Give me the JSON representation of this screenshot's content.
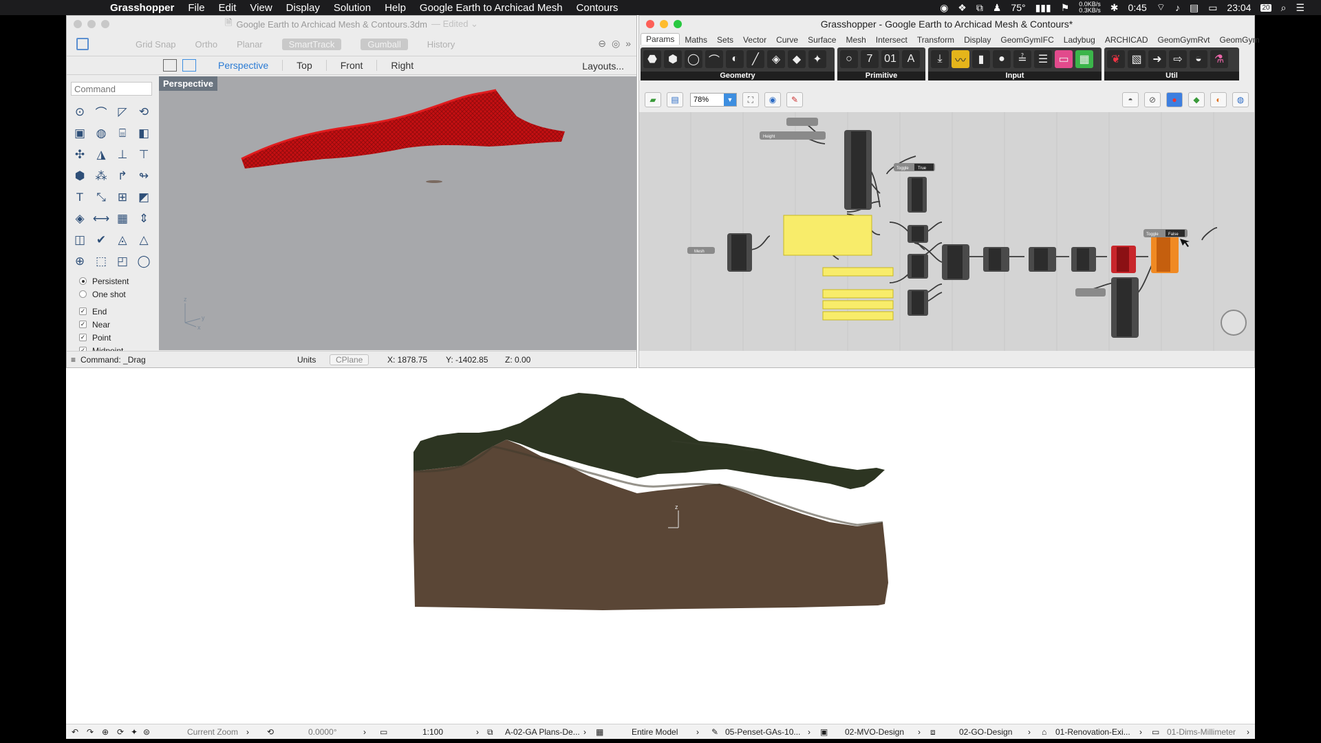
{
  "menubar": {
    "app": "Grasshopper",
    "items": [
      "File",
      "Edit",
      "View",
      "Display",
      "Solution",
      "Help",
      "Google Earth to Archicad Mesh",
      "Contours"
    ],
    "temp": "75°",
    "net_up": "0.0KB/s",
    "net_down": "0.3KB/s",
    "timer": "0:45",
    "clock": "23:04",
    "date_badge": "20"
  },
  "rhino": {
    "title": "Google Earth to Archicad Mesh & Contours.3dm",
    "title_suffix": "— Edited ⌄",
    "toggles": [
      "Grid Snap",
      "Ortho",
      "Planar",
      "SmartTrack",
      "Gumball",
      "History"
    ],
    "view_tabs": [
      "Perspective",
      "Top",
      "Front",
      "Right"
    ],
    "layouts": "Layouts...",
    "command_placeholder": "Command",
    "viewport_label": "Perspective",
    "osnap_modes": [
      "Persistent",
      "One shot"
    ],
    "osnaps": [
      "End",
      "Near",
      "Point",
      "Midpoint"
    ],
    "status": {
      "command": "Command: _Drag",
      "units": "Units",
      "cplane": "CPlane",
      "x": "X: 1878.75",
      "y": "Y: -1402.85",
      "z": "Z: 0.00"
    }
  },
  "grasshopper": {
    "title": "Grasshopper - Google Earth to Archicad Mesh & Contours*",
    "tabs": [
      "Params",
      "Maths",
      "Sets",
      "Vector",
      "Curve",
      "Surface",
      "Mesh",
      "Intersect",
      "Transform",
      "Display",
      "GeomGymIFC",
      "Ladybug",
      "ARCHICAD",
      "GeomGymRvt",
      "GeomGym"
    ],
    "groups": [
      "Geometry",
      "Primitive",
      "Input",
      "Util"
    ],
    "zoom": "78%",
    "nodes": {
      "toggle1_label": "Toggle",
      "toggle1_value": "True",
      "toggle2_label": "Toggle",
      "toggle2_value": "False",
      "height_label": "Height",
      "mesh_label": "Mesh"
    }
  },
  "archicad_status": {
    "zoom_label": "Current Zoom",
    "angle": "0.0000°",
    "scale": "1:100",
    "layer_set": "A-02-GA Plans-De...",
    "model": "Entire Model",
    "penset": "05-Penset-GAs-10...",
    "mvo": "02-MVO-Design",
    "go": "02-GO-Design",
    "renovation": "01-Renovation-Exi...",
    "dims": "01-Dims-Millimeter"
  },
  "colors": {
    "mesh_red": "#c40f12",
    "terrain_top": "#2d3522",
    "terrain_side": "#5a4636",
    "gh_canvas": "#d4d4d4"
  }
}
